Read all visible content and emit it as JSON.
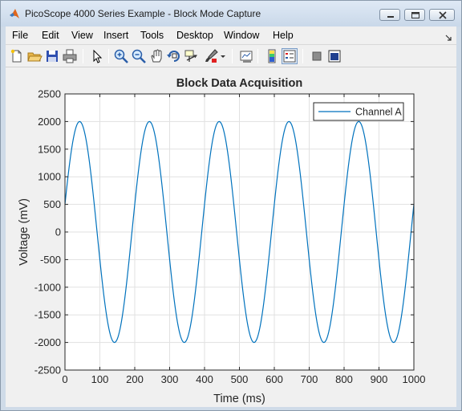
{
  "window": {
    "title": "PicoScope 4000 Series Example - Block Mode Capture"
  },
  "menu": [
    "File",
    "Edit",
    "View",
    "Insert",
    "Tools",
    "Desktop",
    "Window",
    "Help"
  ],
  "toolbar": {
    "icons": [
      "new-figure-icon",
      "open-file-icon",
      "save-icon",
      "print-icon",
      "edit-plot-icon",
      "zoom-in-icon",
      "zoom-out-icon",
      "pan-icon",
      "rotate-3d-icon",
      "data-cursor-icon",
      "brush-icon",
      "brush-dropdown-icon",
      "link-plot-icon",
      "insert-colorbar-icon",
      "insert-legend-icon",
      "hide-plot-tools-icon",
      "show-plot-tools-icon"
    ]
  },
  "colors": {
    "series": "#0072bd",
    "figure_bg": "#f0f0f0",
    "title_bar": "#cfdbe8"
  },
  "chart_data": {
    "type": "line",
    "title": "Block Data Acquisition",
    "xlabel": "Time (ms)",
    "ylabel": "Voltage (mV)",
    "xlim": [
      0,
      1000
    ],
    "ylim": [
      -2500,
      2500
    ],
    "xticks": [
      0,
      100,
      200,
      300,
      400,
      500,
      600,
      700,
      800,
      900,
      1000
    ],
    "yticks": [
      -2500,
      -2000,
      -1500,
      -1000,
      -500,
      0,
      500,
      1000,
      1500,
      2000,
      2500
    ],
    "grid": true,
    "legend": "top-right",
    "series": [
      {
        "name": "Channel A",
        "color": "#0072bd",
        "x": [
          0,
          25,
          50,
          75,
          100,
          125,
          150,
          175,
          200,
          225,
          250,
          275,
          300,
          325,
          350,
          375,
          400,
          425,
          450,
          475,
          500,
          525,
          550,
          575,
          600,
          625,
          650,
          675,
          700,
          725,
          750,
          775,
          800,
          825,
          850,
          875,
          900,
          925,
          950,
          975,
          1000
        ],
        "y": [
          500,
          1767,
          1936,
          875,
          -500,
          -1767,
          -1936,
          -875,
          500,
          1767,
          1936,
          875,
          -500,
          -1767,
          -1936,
          -875,
          500,
          1767,
          1936,
          875,
          -500,
          -1767,
          -1936,
          -875,
          500,
          1767,
          1936,
          875,
          -500,
          -1767,
          -1936,
          -875,
          500,
          1767,
          1936,
          875,
          -500,
          -1767,
          -1936,
          -875,
          500
        ]
      }
    ]
  }
}
